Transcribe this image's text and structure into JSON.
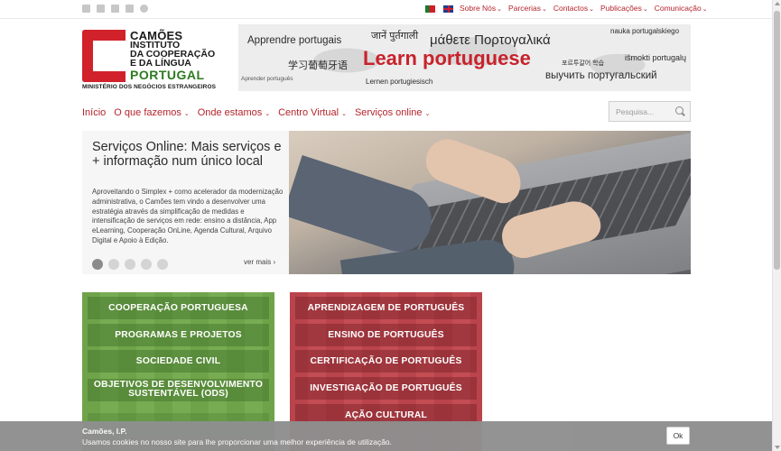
{
  "social": {
    "icons": [
      "facebook-icon",
      "twitter-icon",
      "youtube-icon",
      "linkedin-icon",
      "chat-icon"
    ]
  },
  "languages": [
    {
      "flag": "portugal-flag-icon",
      "code": "PT"
    },
    {
      "flag": "uk-flag-icon",
      "code": "EN"
    }
  ],
  "topnav": {
    "items": [
      {
        "label": "Sobre Nós"
      },
      {
        "label": "Parcerias"
      },
      {
        "label": "Contactos"
      },
      {
        "label": "Publicações"
      },
      {
        "label": "Comunicação"
      }
    ]
  },
  "logo": {
    "line1": "CAMÕES",
    "line2": "INSTITUTO",
    "line3": "DA COOPERAÇÃO",
    "line4": "E DA LÍNGUA",
    "line5": "PORTUGAL",
    "line6": "MINISTÉRIO DOS NEGÓCIOS ESTRANGEIROS"
  },
  "banner": {
    "words": [
      "Apprendre portugais",
      "जानें पुर्तगाली",
      "μάθετε Πορτογαλικά",
      "nauka portugalskiego",
      "学习葡萄牙语",
      "Learn portuguese",
      "포르투갈어 학습",
      "išmokti portugalų",
      "Aprender português",
      "Lernen portugiesisch",
      "выучить португальский"
    ]
  },
  "mainnav": {
    "items": [
      {
        "label": "Início",
        "dropdown": false
      },
      {
        "label": "O que fazemos",
        "dropdown": true
      },
      {
        "label": "Onde estamos",
        "dropdown": true
      },
      {
        "label": "Centro Virtual",
        "dropdown": true
      },
      {
        "label": "Serviços online",
        "dropdown": true
      }
    ]
  },
  "search": {
    "placeholder": "Pesquisa..."
  },
  "carousel": {
    "title": "Serviços Online: Mais serviços e + informação num único local",
    "body": "Aproveitando o Simplex + como acelerador da modernização administrativa, o Camões tem vindo a desenvolver uma estratégia através da simplificação de medidas e intensificação de serviços em rede: ensino a distância, App eLearning, Cooperação OnLine, Agenda Cultural, Arquivo Digital e Apoio à Edição.",
    "more_label": "ver mais",
    "more_icon": "›",
    "slide_count": 5,
    "active_slide": 1
  },
  "panels": {
    "cooperation": [
      "COOPERAÇÃO PORTUGUESA",
      "PROGRAMAS E PROJETOS",
      "SOCIEDADE CIVIL",
      "OBJETIVOS DE DESENVOLVIMENTO SUSTENTÁVEL (ODS)"
    ],
    "language": [
      "APRENDIZAGEM DE PORTUGUÊS",
      "ENSINO DE PORTUGUÊS",
      "CERTIFICAÇÃO DE PORTUGUÊS",
      "INVESTIGAÇÃO DE PORTUGUÊS",
      "AÇÃO CULTURAL"
    ]
  },
  "cookie": {
    "title": "Camões, I.P.",
    "text": "Usamos cookies no nosso site para lhe proporcionar uma melhor experiência de utilização.",
    "button": "Ok"
  },
  "colors": {
    "brand_red": "#b5242b",
    "logo_red": "#d1222b",
    "logo_green": "#2f7a22",
    "panel_green": "#6fa34a",
    "panel_red": "#b9444b"
  }
}
